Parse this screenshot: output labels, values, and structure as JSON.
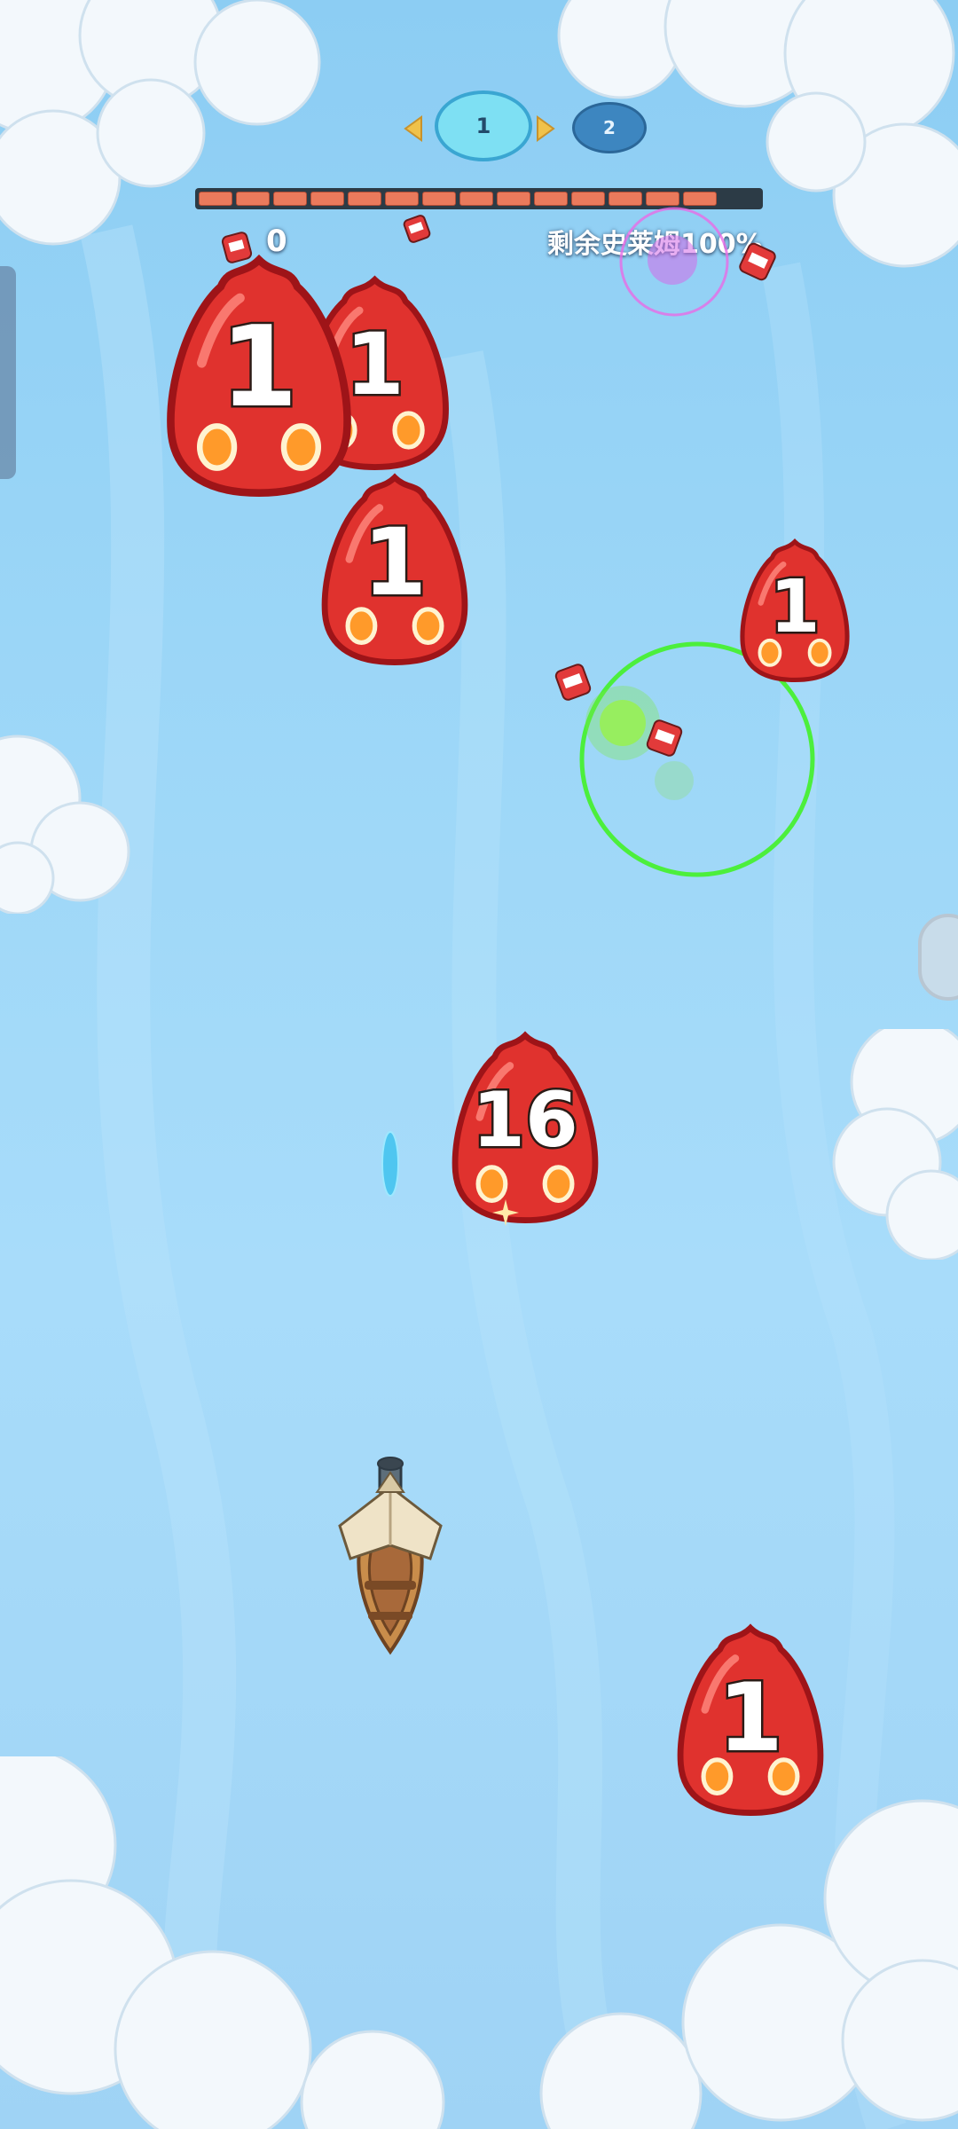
{
  "level_nav": {
    "current": "1",
    "next": "2",
    "prev_arrow_color": "#f0c24a",
    "next_arrow_color": "#f0c24a"
  },
  "hud": {
    "score": "0",
    "remaining_label": "剩余史莱姆100%",
    "remaining_progress": 1.0,
    "bar_color": "#ea7a5c"
  },
  "slimes": [
    {
      "id": "slime-a",
      "value": "1"
    },
    {
      "id": "slime-b",
      "value": "1"
    },
    {
      "id": "slime-c",
      "value": "1"
    },
    {
      "id": "slime-d",
      "value": "1"
    },
    {
      "id": "slime-e",
      "value": "16"
    },
    {
      "id": "slime-f",
      "value": "1"
    }
  ],
  "colors": {
    "slime_red": "#e0322e",
    "slime_dark": "#9e1418",
    "sky_top": "#8ccdf3",
    "level_active": "#7ee0f3",
    "level_next": "#3d86c0",
    "ring_green": "#4cef3c",
    "ring_pink": "#e86be6"
  },
  "icons": [
    "potion-icon",
    "boat-player",
    "projectile",
    "green-burst",
    "pink-burst",
    "cloud"
  ]
}
